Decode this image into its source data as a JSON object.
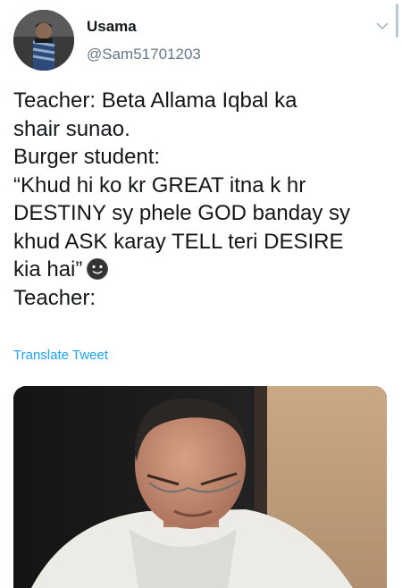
{
  "user": {
    "display_name": "Usama",
    "handle": "@Sam51701203"
  },
  "icons": {
    "menu": "chevron-down-icon",
    "emoji": "slightly-smiling-face-emoji"
  },
  "tweet": {
    "lines": [
      "Teacher: Beta Allama Iqbal ka",
      "shair sunao.",
      "Burger student:",
      "“Khud hi ko kr GREAT itna k hr",
      "DESTINY sy phele GOD banday sy",
      "khud ASK karay TELL teri DESIRE",
      "kia hai”",
      "Teacher:"
    ]
  },
  "translate_label": "Translate Tweet",
  "colors": {
    "text": "#14171a",
    "secondary": "#657786",
    "link": "#1da1f2"
  }
}
